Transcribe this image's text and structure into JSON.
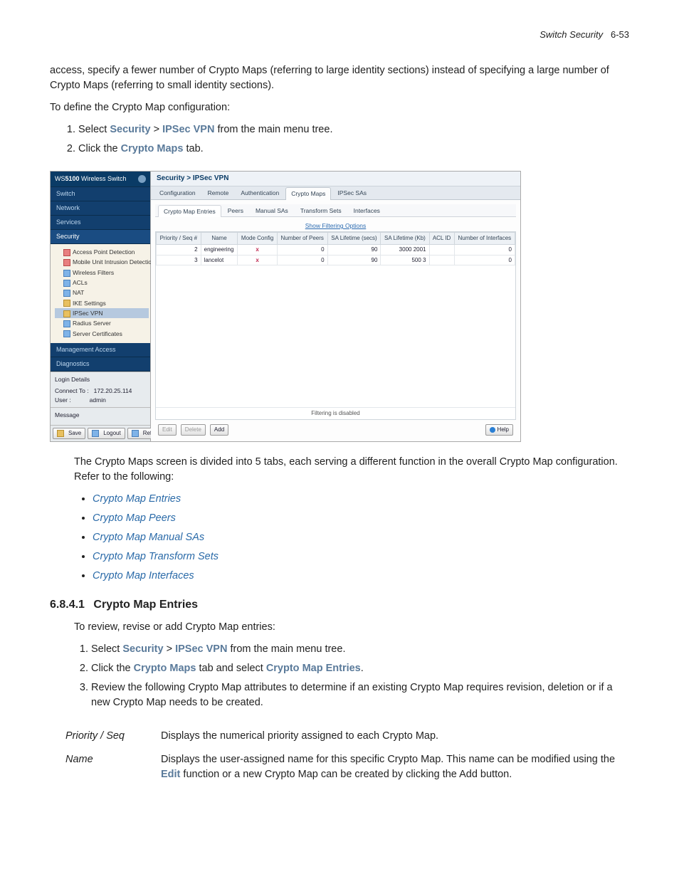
{
  "page_header": {
    "title": "Switch Security",
    "num": "6-53"
  },
  "p_intro": "access, specify a fewer number of Crypto Maps (referring to large identity sections) instead of specifying a large number of Crypto Maps (referring to small identity sections).",
  "p_define": "To define the Crypto Map configuration:",
  "step1_pre": "Select ",
  "step1_b1": "Security",
  "step1_mid": " > ",
  "step1_b2": "IPSec VPN",
  "step1_post": " from the main menu tree.",
  "step2_pre": "Click the ",
  "step2_b1": "Crypto Maps",
  "step2_post": " tab.",
  "p_after_ss1": "The Crypto Maps screen is divided into 5 tabs, each serving a different function in the overall Crypto Map configuration. Refer to the following:",
  "links": [
    "Crypto Map Entries",
    "Crypto Map Peers",
    "Crypto Map Manual SAs",
    "Crypto Map Transform Sets",
    "Crypto Map Interfaces"
  ],
  "section": {
    "num": "6.8.4.1",
    "title": "Crypto Map Entries"
  },
  "p_review": "To review, revise or add Crypto Map entries:",
  "s2_step1_pre": "Select ",
  "s2_step1_b1": "Security",
  "s2_step1_mid": " > ",
  "s2_step1_b2": "IPSec VPN",
  "s2_step1_post": " from the main menu tree.",
  "s2_step2_pre": "Click the ",
  "s2_step2_b1": "Crypto Maps",
  "s2_step2_mid": " tab and select ",
  "s2_step2_b2": "Crypto Map Entries",
  "s2_step2_post": ".",
  "s2_step3": "Review the following Crypto Map attributes to determine if an existing Crypto Map requires revision, deletion or if a new Crypto Map needs to be created.",
  "fields": {
    "f1_term": "Priority / Seq",
    "f1_desc": "Displays the numerical priority assigned to each Crypto Map.",
    "f2_term": "Name",
    "f2_desc_pre": "Displays the user-assigned name for this specific Crypto Map. This name can be modified using the ",
    "f2_desc_b": "Edit",
    "f2_desc_post": " function or a new Crypto Map can be created by clicking the Add button."
  },
  "ss": {
    "brand_pre": "WS",
    "brand_bold": "5100",
    "brand_post": " Wireless Switch",
    "nav": {
      "switch": "Switch",
      "network": "Network",
      "services": "Services",
      "security": "Security",
      "mgmt": "Management Access",
      "diag": "Diagnostics"
    },
    "tree": {
      "apd": "Access Point Detection",
      "muid": "Mobile Unit Intrusion Detection",
      "wf": "Wireless Filters",
      "acls": "ACLs",
      "nat": "NAT",
      "ike": "IKE Settings",
      "ipsec": "IPSec VPN",
      "radius": "Radius Server",
      "certs": "Server Certificates"
    },
    "login": {
      "title": "Login Details",
      "connect_lbl": "Connect To :",
      "connect_val": "172.20.25.114",
      "user_lbl": "User :",
      "user_val": "admin",
      "msg_title": "Message"
    },
    "toolbar": {
      "save": "Save",
      "logout": "Logout",
      "refresh": "Refresh"
    },
    "crumb": "Security > IPSec VPN",
    "tabs": [
      "Configuration",
      "Remote",
      "Authentication",
      "Crypto Maps",
      "IPSec SAs"
    ],
    "subtabs": [
      "Crypto Map Entries",
      "Peers",
      "Manual SAs",
      "Transform Sets",
      "Interfaces"
    ],
    "filter_link": "Show Filtering Options",
    "columns": {
      "c0": "Priority / Seq #",
      "c1": "Name",
      "c2": "Mode Config",
      "c3": "Number of Peers",
      "c4": "SA Lifetime (secs)",
      "c5": "SA Lifetime (Kb)",
      "c6": "ACL ID",
      "c7": "Number of Interfaces"
    },
    "chart_data": {
      "type": "table",
      "rows": [
        {
          "priority_seq": 2,
          "name": "engineering",
          "mode_config": "x",
          "number_of_peers": 0,
          "sa_lifetime_secs": 90,
          "sa_lifetime_kb": "3000 2001",
          "acl_id": "",
          "number_of_interfaces": 0
        },
        {
          "priority_seq": 3,
          "name": "lancelot",
          "mode_config": "x",
          "number_of_peers": 0,
          "sa_lifetime_secs": 90,
          "sa_lifetime_kb": "500 3",
          "acl_id": "",
          "number_of_interfaces": 0
        }
      ]
    },
    "filter_status": "Filtering is disabled",
    "actions": {
      "edit": "Edit",
      "delete": "Delete",
      "add": "Add",
      "help": "Help"
    }
  }
}
